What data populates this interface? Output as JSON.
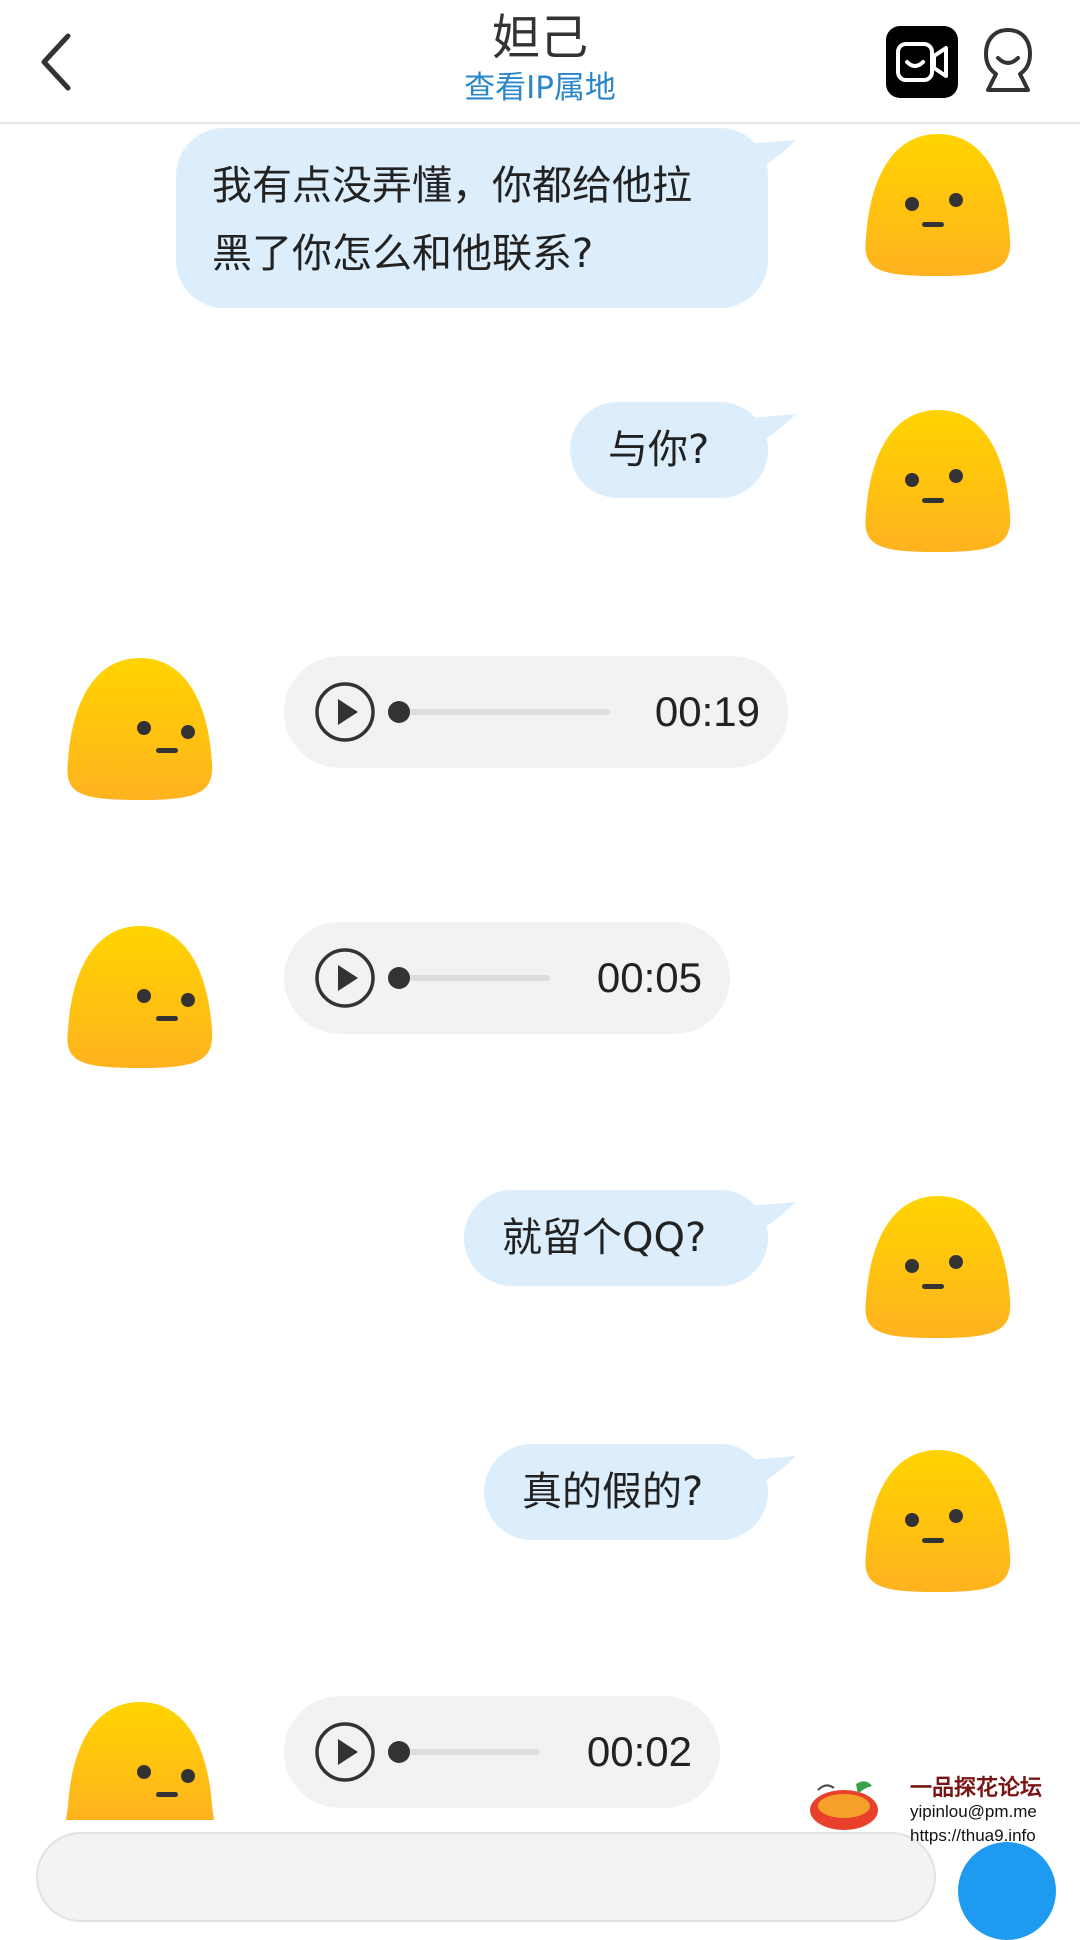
{
  "header": {
    "title": "妲己",
    "subtitle": "查看IP属地",
    "icons": [
      "back-chevron-icon",
      "video-call-icon",
      "profile-icon"
    ]
  },
  "messages": [
    {
      "side": "right",
      "type": "text",
      "lines": [
        "我有点没弄懂，你都给他拉",
        "黑了你怎么和他联系?"
      ]
    },
    {
      "side": "right",
      "type": "text",
      "lines": [
        "与你?"
      ]
    },
    {
      "side": "left",
      "type": "voice",
      "duration": "00:19"
    },
    {
      "side": "left",
      "type": "voice",
      "duration": "00:05"
    },
    {
      "side": "right",
      "type": "text",
      "lines": [
        "就留个QQ?"
      ]
    },
    {
      "side": "right",
      "type": "text",
      "lines": [
        "真的假的?"
      ]
    },
    {
      "side": "left",
      "type": "voice",
      "duration": "00:02"
    }
  ],
  "watermark": {
    "title": "一品探花论坛",
    "email": "yipinlou@pm.me",
    "url": "https://thua9.info"
  },
  "colors": {
    "outgoing_bubble": "#dcedfb",
    "voice_bubble": "#f2f2f2",
    "subtitle_link": "#2b87c9",
    "avatar_yellow": "#ffc91a",
    "send_button": "#1e9bf0"
  }
}
